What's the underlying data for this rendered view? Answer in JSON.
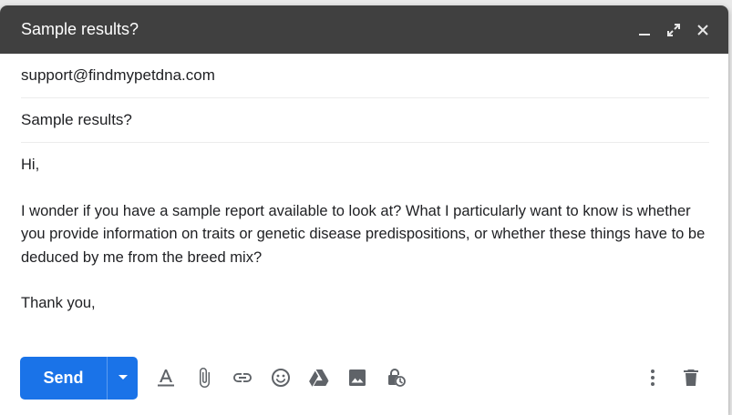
{
  "window": {
    "title": "Sample results?",
    "minimize_icon": "minimize-icon",
    "fullscreen_icon": "expand-icon",
    "close_icon": "close-icon"
  },
  "recipients": {
    "to": "support@findmypetdna.com"
  },
  "subject": {
    "value": "Sample results?"
  },
  "body": {
    "greeting": "Hi,",
    "paragraph": "I wonder if you have a sample report available to look at? What I particularly want to know is whether you provide information on traits or genetic disease predispositions, or whether these things have to be deduced by me from the breed mix?",
    "closing": "Thank you,"
  },
  "toolbar": {
    "send_label": "Send",
    "tools": [
      "format-text-icon",
      "attach-icon",
      "link-icon",
      "emoji-icon",
      "drive-icon",
      "photo-icon",
      "confidential-icon"
    ],
    "more_icon": "more-options-icon",
    "delete_icon": "trash-icon"
  },
  "colors": {
    "titlebar": "#404040",
    "send": "#1a73e8",
    "icon": "#5f6368"
  }
}
